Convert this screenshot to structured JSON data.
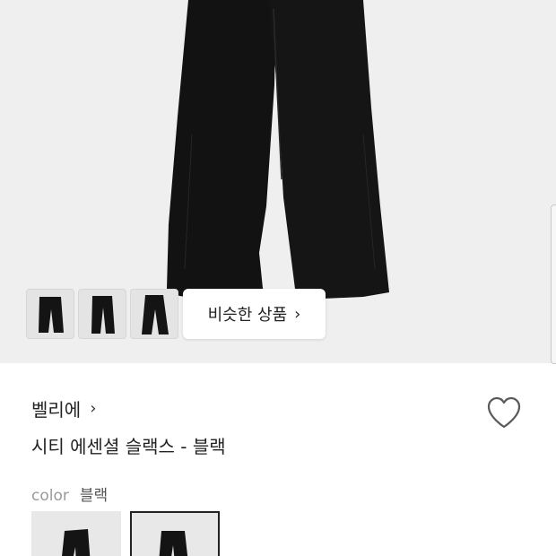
{
  "gallery": {
    "main_image_icon": "pants-photo",
    "thumbnail_icons": [
      "pants-thumb-icon",
      "pants-thumb-icon",
      "pants-thumb-icon"
    ],
    "similar_button_label": "비슷한 상품",
    "similar_button_chevron": "›"
  },
  "product": {
    "brand": "벨리에",
    "brand_chevron": "›",
    "title": "시티 에센셜 슬랙스 - 블랙",
    "wishlist_icon": "heart-outline-icon"
  },
  "options": {
    "color_label": "color",
    "color_value": "블랙",
    "swatch_icons": [
      "pants-swatch-icon",
      "pants-swatch-icon"
    ],
    "selected_swatch": 2
  },
  "colors": {
    "hero_background": "#efefef",
    "pants": "#121212",
    "selected_border": "#222222",
    "muted_text": "#9a9a9a"
  }
}
